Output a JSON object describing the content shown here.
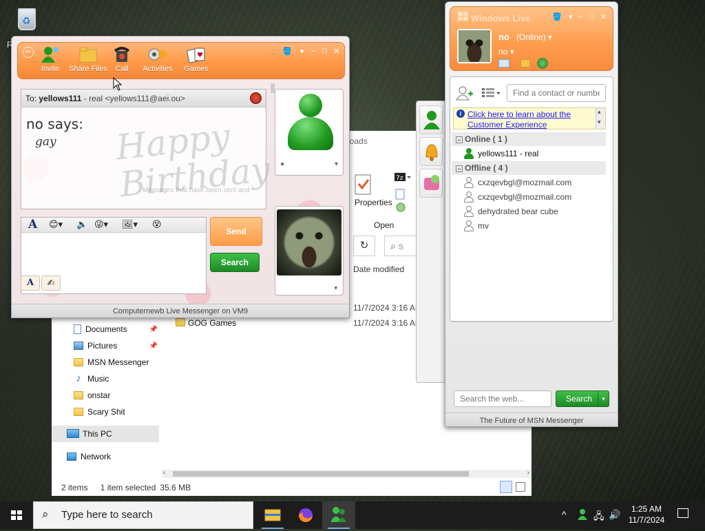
{
  "desktop": {
    "recycle_bin_label": "R"
  },
  "explorer": {
    "ribbon_loads_label": "loads",
    "properties_label": "Properties",
    "open_label": "Open",
    "date_modified_header": "Date modified",
    "search_partial": "S",
    "rows": [
      {
        "name": "",
        "date": "11/7/2024 3:16 AM"
      },
      {
        "name": "GOG Games",
        "date": "11/7/2024 3:16 AM"
      }
    ],
    "nav_items": [
      {
        "label": "Documents",
        "icon": "document-icon",
        "pinned": true
      },
      {
        "label": "Pictures",
        "icon": "pictures-icon",
        "pinned": true
      },
      {
        "label": "MSN Messenger",
        "icon": "folder-icon",
        "pinned": false
      },
      {
        "label": "Music",
        "icon": "music-icon",
        "pinned": false
      },
      {
        "label": "onstar",
        "icon": "folder-icon",
        "pinned": false
      },
      {
        "label": "Scary Shit",
        "icon": "folder-icon",
        "pinned": false
      }
    ],
    "this_pc_label": "This PC",
    "network_label": "Network",
    "status": {
      "item_count": "2 items",
      "selected": "1 item selected",
      "size": "35.6 MB"
    }
  },
  "chat": {
    "toolbar": [
      {
        "label": "Invite",
        "icon": "invite-icon"
      },
      {
        "label": "Share Files",
        "icon": "share-files-icon"
      },
      {
        "label": "Call",
        "icon": "call-icon"
      },
      {
        "label": "Activities",
        "icon": "activities-icon"
      },
      {
        "label": "Games",
        "icon": "games-icon"
      }
    ],
    "to_prefix": "To:",
    "to_name": "yellows111",
    "to_rest": "- real <yellows111@aei.ou>",
    "message_sender_line": "no says:",
    "message_text": "gay",
    "background_text": "Happy Birthday",
    "background_note": "Messages that have been sent and",
    "send_label": "Send",
    "search_label": "Search",
    "footer": "Computernewb Live Messenger on VM9"
  },
  "contact_list": {
    "title": "Windows Live",
    "self_name": "no",
    "self_status": "(Online)",
    "self_psm": "no",
    "find_placeholder": "Find a contact or number...",
    "ad_text": "Click here to learn about the Customer Experience",
    "groups": [
      {
        "label": "Online ( 1 )",
        "contacts": [
          {
            "name": "yellows111 - real",
            "online": true
          }
        ]
      },
      {
        "label": "Offline ( 4 )",
        "contacts": [
          {
            "name": "cxzqevbgl@mozmail.com",
            "online": false
          },
          {
            "name": "cxzqevbgl@mozmail.com",
            "online": false
          },
          {
            "name": "dehydrated bear cube",
            "online": false
          },
          {
            "name": "mv",
            "online": false
          }
        ]
      }
    ],
    "web_search_placeholder": "Search the web...",
    "web_search_button": "Search",
    "footer": "The Future of MSN Messenger"
  },
  "taskbar": {
    "search_placeholder": "Type here to search",
    "time": "1:25 AM",
    "date": "11/7/2024",
    "apps": [
      "file-explorer-icon",
      "firefox-icon",
      "messenger-icon"
    ]
  },
  "colors": {
    "msn_orange": "#ff9a47",
    "msn_green": "#1f9a1f",
    "link_blue": "#1a1aff"
  }
}
